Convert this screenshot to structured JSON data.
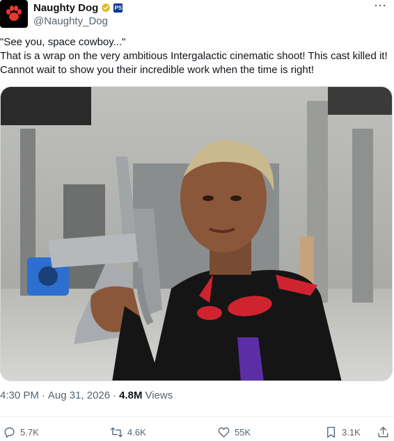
{
  "account": {
    "display_name": "Naughty Dog",
    "handle": "@Naughty_Dog",
    "ps_badge_glyph": "PS"
  },
  "post": {
    "text_line1": "\"See you, space cowboy...\"",
    "text_body": "That is a wrap on the very ambitious Intergalactic cinematic shoot! This cast killed it! Cannot wait to show you their incredible work when the time is right!"
  },
  "meta": {
    "time": "4:30 PM",
    "sep1": "·",
    "date": "Aug 31, 2026",
    "sep2": "·",
    "views_count": "4.8M",
    "views_label": "Views"
  },
  "actions": {
    "replies": "5.7K",
    "reposts": "4.6K",
    "likes": "55K",
    "bookmarks": "3.1K"
  },
  "icons": [
    "paw-logo-icon",
    "verified-badge-icon",
    "playstation-badge-icon",
    "more-icon",
    "reply-icon",
    "repost-icon",
    "like-icon",
    "bookmark-icon",
    "share-icon"
  ],
  "colors": {
    "verified_gold": "#e2b719",
    "ps_blue": "#003791",
    "paw_red": "#e8372f",
    "muted": "#536471"
  }
}
